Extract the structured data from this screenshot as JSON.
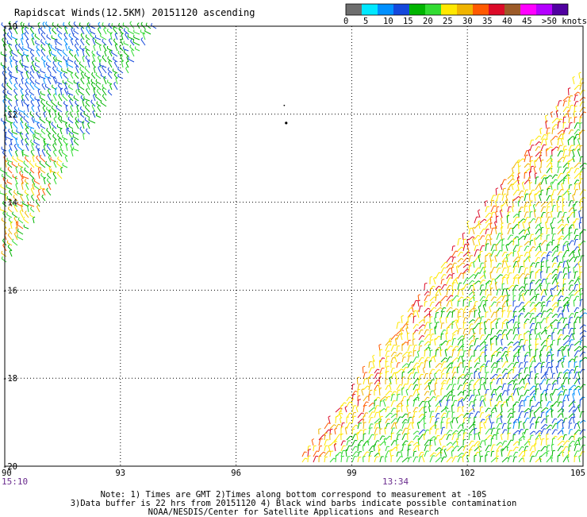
{
  "title": "Rapidscat Winds(12.5KM) 20151120 ascending",
  "colorbar": {
    "colors": [
      "#6e6e6e",
      "#00e8ff",
      "#0090ff",
      "#1448dc",
      "#00b400",
      "#32dc32",
      "#ffe800",
      "#f0b400",
      "#ff5a00",
      "#dc0a28",
      "#9c5a28",
      "#ff00ff",
      "#b400ff",
      "#5000a0"
    ],
    "labels": [
      "0",
      "5",
      "10",
      "15",
      "20",
      "25",
      "30",
      "35",
      "40",
      "45",
      ">50 knots"
    ]
  },
  "axes": {
    "x_ticks": [
      "90",
      "93",
      "96",
      "99",
      "102",
      "105"
    ],
    "y_ticks": [
      "-10",
      "-12",
      "-14",
      "-16",
      "-18",
      "-20"
    ],
    "lon_range": [
      90,
      105
    ],
    "lat_range": [
      -20,
      -10
    ]
  },
  "times": {
    "left": "15:10",
    "middle": "13:34"
  },
  "notes": {
    "line1": "Note: 1) Times are GMT 2)Times along bottom correspond to measurement at -10S",
    "line2": "3)Data buffer is 22 hrs from 20151120 4) Black wind barbs indicate possible contamination",
    "line3": "NOAA/NESDIS/Center for Satellite Applications and Research"
  }
}
